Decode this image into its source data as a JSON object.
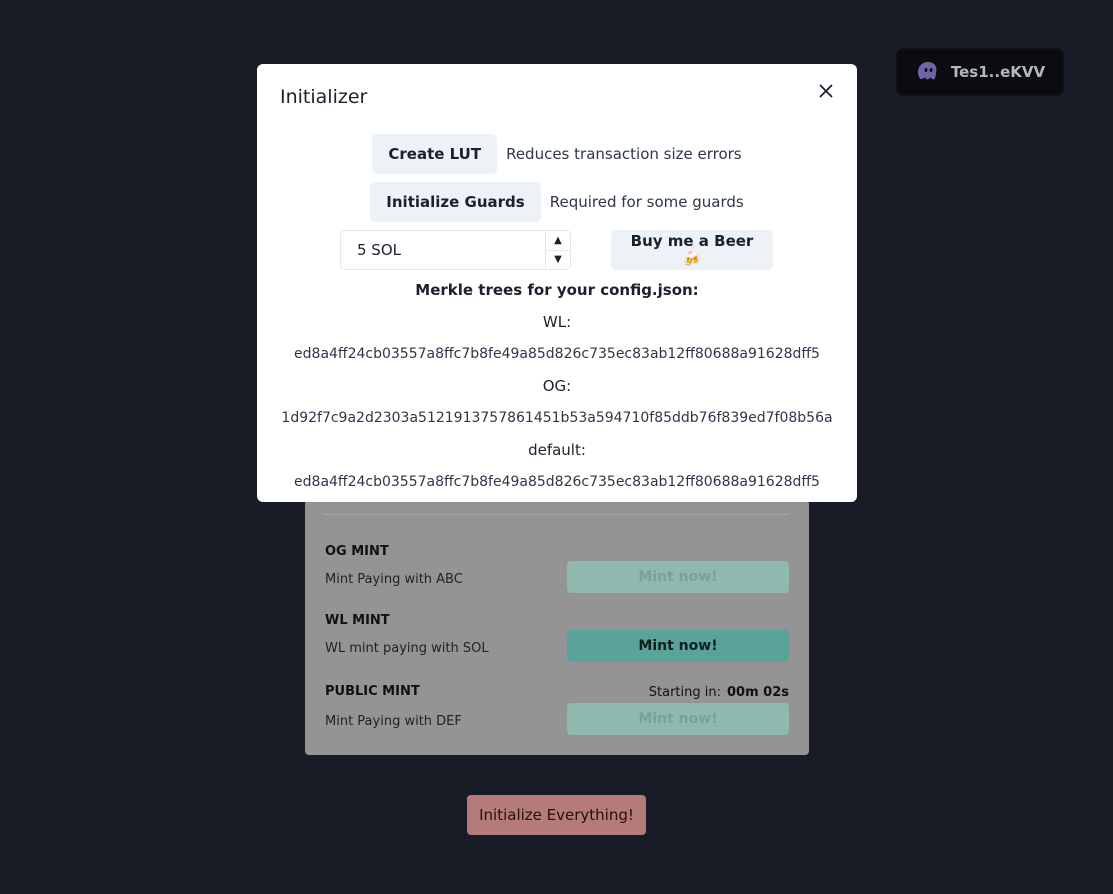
{
  "wallet": {
    "label": "Tes1..eKVV",
    "icon": "ghost-icon"
  },
  "modal": {
    "title": "Initializer",
    "create_lut": {
      "label": "Create LUT",
      "note": "Reduces transaction size errors"
    },
    "init_guards": {
      "label": "Initialize Guards",
      "note": "Required for some guards"
    },
    "amount_input": {
      "value": "5 SOL"
    },
    "beer_button": {
      "label": "Buy me a Beer 🍻"
    },
    "merkle": {
      "heading": "Merkle trees for your config.json:",
      "trees": [
        {
          "label": "WL:",
          "hash": "ed8a4ff24cb03557a8ffc7b8fe49a85d826c735ec83ab12ff80688a91628dff5"
        },
        {
          "label": "OG:",
          "hash": "1d92f7c9a2d2303a5121913757861451b53a594710f85ddb76f839ed7f08b56a"
        },
        {
          "label": "default:",
          "hash": "ed8a4ff24cb03557a8ffc7b8fe49a85d826c735ec83ab12ff80688a91628dff5"
        }
      ]
    }
  },
  "mints": [
    {
      "title": "OG MINT",
      "desc": "Mint Paying with ABC",
      "button": "Mint now!",
      "state": "disabled"
    },
    {
      "title": "WL MINT",
      "desc": "WL mint paying with SOL",
      "button": "Mint now!",
      "state": "active"
    },
    {
      "title": "PUBLIC MINT",
      "desc": "Mint Paying with DEF",
      "button": "Mint now!",
      "state": "disabled",
      "starting_label": "Starting in:",
      "countdown": "00m 02s"
    }
  ],
  "init_everything": {
    "label": "Initialize Everything!"
  },
  "colors": {
    "background": "#171c27",
    "teal": "#5aa39a",
    "danger": "#b57a7a"
  }
}
